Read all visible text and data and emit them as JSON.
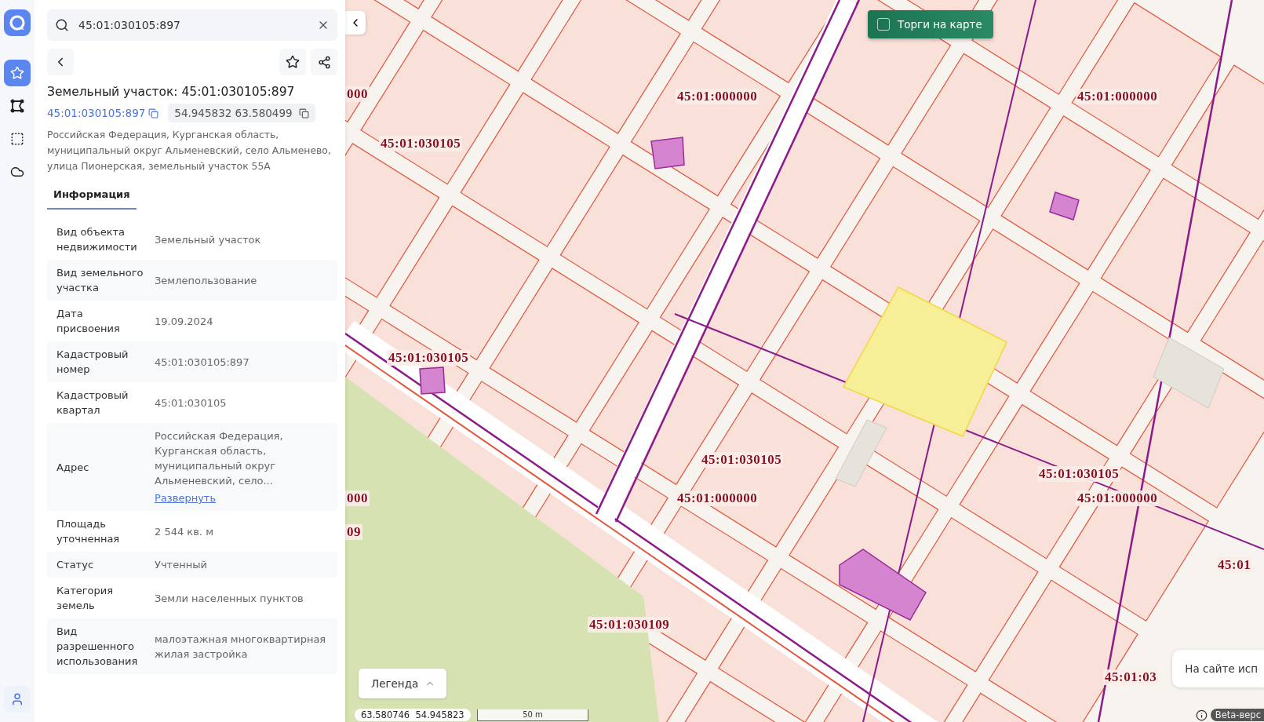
{
  "rail": {
    "items": [
      {
        "kind": "star",
        "selected": true
      },
      {
        "kind": "polygon",
        "selected": false
      },
      {
        "kind": "selection",
        "selected": false
      },
      {
        "kind": "cloud",
        "selected": false
      }
    ],
    "bottom": [
      {
        "kind": "user",
        "selected": false
      }
    ]
  },
  "search": {
    "value": "45:01:030105:897"
  },
  "object": {
    "title": "Земельный участок: 45:01:030105:897",
    "cadastral_link": "45:01:030105:897",
    "coordinates": "54.945832 63.580499",
    "address": "Российская Федерация, Курганская область, муниципальный округ Альменевский, село Альменево, улица Пионерская, земельный участок 55А"
  },
  "tabs": [
    {
      "label": "Информация",
      "selected": true
    }
  ],
  "properties": [
    {
      "label": "Вид объекта недвижимости",
      "value": "Земельный участок"
    },
    {
      "label": "Вид земельного участка",
      "value": "Землепользование"
    },
    {
      "label": "Дата присвоения",
      "value": "19.09.2024"
    },
    {
      "label": "Кадастровый номер",
      "value": "45:01:030105:897"
    },
    {
      "label": "Кадастровый квартал",
      "value": "45:01:030105"
    },
    {
      "label": "Адрес",
      "value": "Российская Федерация, Курганская область, муниципальный округ Альменевский, село...",
      "link": "Развернуть"
    },
    {
      "label": "Площадь уточненная",
      "value": "2 544 кв. м"
    },
    {
      "label": "Статус",
      "value": "Учтенный"
    },
    {
      "label": "Категория земель",
      "value": "Земли населенных пунктов"
    },
    {
      "label": "Вид разрешенного использования",
      "value": "малоэтажная многоквартирная жилая застройка"
    }
  ],
  "map": {
    "trade_toggle": {
      "label": "Торги на карте",
      "checked": false
    },
    "labels": [
      "000",
      "45:01:000000",
      "45:01:000000",
      "45:01:030105",
      "45:01:030105",
      "45:01:030105",
      "45:01:030105",
      "000",
      "45:01:000000",
      "45:01:000000",
      "09",
      "45:01",
      "45:01:030109",
      "45:01:03"
    ],
    "legend": "Легенда",
    "cursor_coords": "63.580746  54.945823",
    "scale": "50 m",
    "beta": "Beta-верс",
    "notice": "На сайте исп"
  }
}
